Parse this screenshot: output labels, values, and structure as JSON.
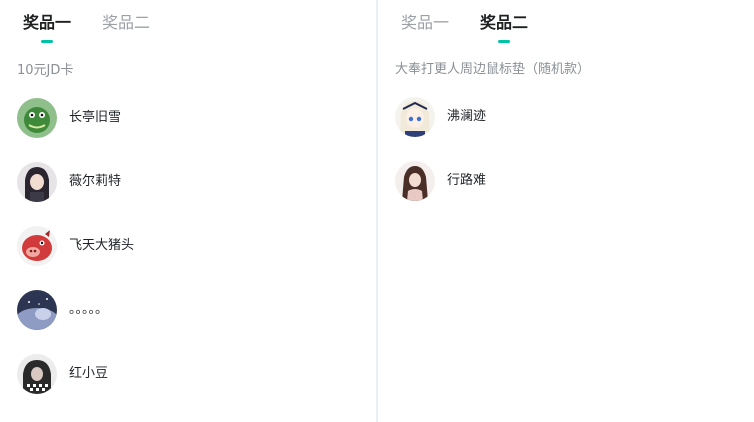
{
  "left_panel": {
    "tabs": [
      {
        "label": "奖品一",
        "active": true
      },
      {
        "label": "奖品二",
        "active": false
      }
    ],
    "prize_name": "10元JD卡",
    "winners": [
      {
        "name": "长亭旧雪"
      },
      {
        "name": "薇尔莉特"
      },
      {
        "name": "飞天大猪头"
      },
      {
        "name": "。。。。。"
      },
      {
        "name": "红小豆"
      }
    ]
  },
  "right_panel": {
    "tabs": [
      {
        "label": "奖品一",
        "active": false
      },
      {
        "label": "奖品二",
        "active": true
      }
    ],
    "prize_name": "大奉打更人周边鼠标垫（随机款）",
    "winners": [
      {
        "name": "沸澜迹"
      },
      {
        "name": "行路难"
      }
    ]
  },
  "colors": {
    "accent": "#00c4a7",
    "active_tab": "#1d1f21",
    "inactive_tab": "#9aa0a6",
    "background": "#e9eef3"
  }
}
